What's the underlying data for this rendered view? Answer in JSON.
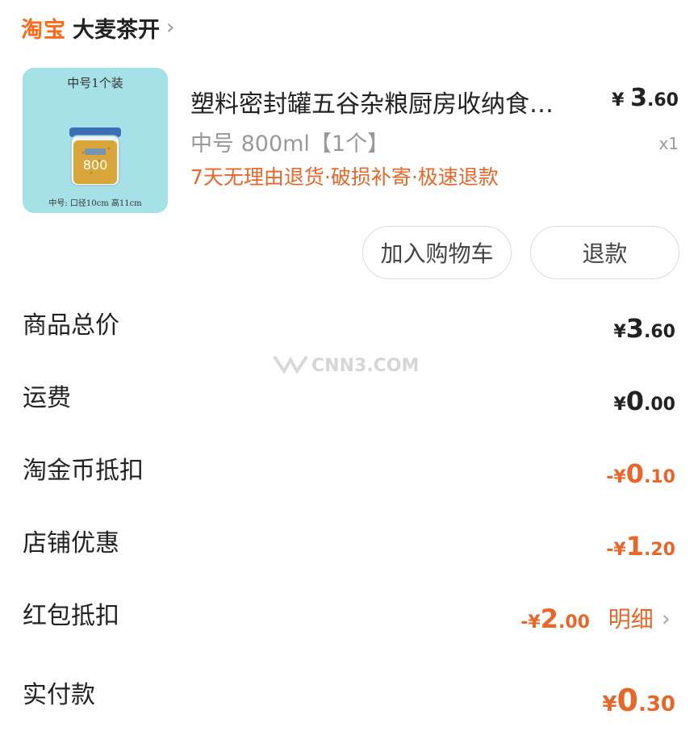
{
  "shop": {
    "logo": "淘宝",
    "name": "大麦茶开",
    "chevron": "›"
  },
  "product": {
    "thumb_top": "中号1个装",
    "thumb_bottom": "中号: 口径10cm 高11cm",
    "jar_label": "800",
    "title": "塑料密封罐五谷杂粮厨房收纳食…",
    "price_symbol": "¥",
    "price_int": "3",
    "price_dec": ".60",
    "spec": "中号 800ml【1个】",
    "qty": "x1",
    "service": "7天无理由退货·破损补寄·极速退款"
  },
  "buttons": {
    "add_cart": "加入购物车",
    "refund": "退款"
  },
  "summary": [
    {
      "label": "商品总价",
      "prefix": "¥",
      "int": "3",
      "dec": ".60",
      "color": "default"
    },
    {
      "label": "运费",
      "prefix": "¥",
      "int": "0",
      "dec": ".00",
      "color": "default"
    },
    {
      "label": "淘金币抵扣",
      "prefix": "-¥",
      "int": "0",
      "dec": ".10",
      "color": "#e8662a"
    },
    {
      "label": "店铺优惠",
      "prefix": "-¥",
      "int": "1",
      "dec": ".20",
      "color": "#e8662a"
    },
    {
      "label": "红包抵扣",
      "prefix": "-¥",
      "int": "2",
      "dec": ".00",
      "color": "#e8662a"
    },
    {
      "label": "实付款",
      "prefix": "¥",
      "int": "0",
      "dec": ".30",
      "color": "#e8662a"
    }
  ],
  "detail_link": "明细",
  "watermark": "CNN3.COM"
}
